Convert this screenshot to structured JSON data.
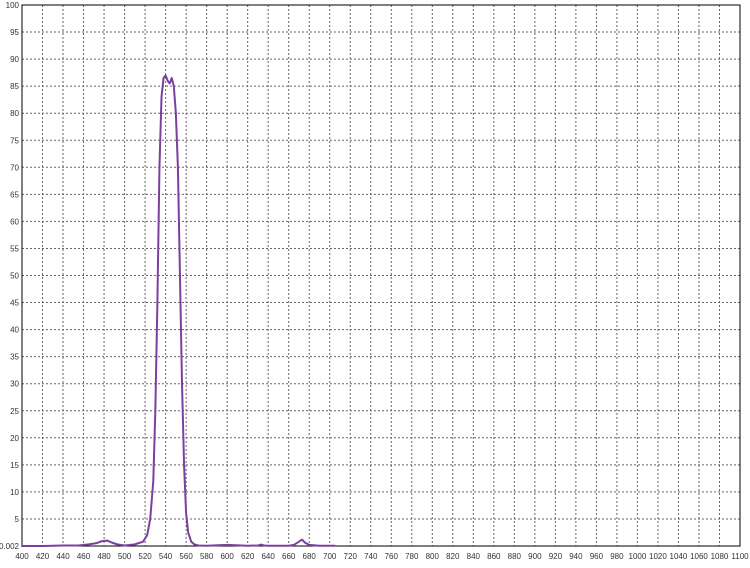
{
  "chart_data": {
    "type": "line",
    "title": "",
    "xlabel": "",
    "ylabel": "",
    "xlim": [
      400,
      1100
    ],
    "ylim": [
      0,
      100
    ],
    "grid": true,
    "x_ticks": [
      400,
      420,
      440,
      460,
      480,
      500,
      520,
      540,
      560,
      580,
      600,
      620,
      640,
      660,
      680,
      700,
      720,
      740,
      760,
      780,
      800,
      820,
      840,
      860,
      880,
      900,
      920,
      940,
      960,
      980,
      1000,
      1020,
      1040,
      1060,
      1080,
      1100
    ],
    "y_ticks": [
      0.002,
      5,
      10,
      15,
      20,
      25,
      30,
      35,
      40,
      45,
      50,
      55,
      60,
      65,
      70,
      75,
      80,
      85,
      90,
      95,
      100
    ],
    "colors": {
      "series": "#7b3fa0",
      "axis": "#000000",
      "grid": "#666666"
    },
    "series": [
      {
        "x": [
          400,
          420,
          440,
          455,
          465,
          472,
          478,
          483,
          488,
          493,
          500,
          510,
          518,
          522,
          525,
          528,
          530,
          532,
          534,
          536,
          538,
          540,
          542,
          544,
          546,
          548,
          550,
          552,
          554,
          556,
          558,
          560,
          562,
          565,
          568,
          572,
          580,
          600,
          620,
          630,
          633,
          636,
          640,
          660,
          665,
          670,
          673,
          676,
          680,
          690,
          700,
          705
        ],
        "y": [
          0.002,
          0.002,
          0.1,
          0.1,
          0.3,
          0.5,
          0.9,
          1.0,
          0.6,
          0.3,
          0.1,
          0.3,
          0.8,
          2,
          5,
          12,
          25,
          45,
          70,
          83,
          86.5,
          87,
          86,
          85.5,
          86.5,
          85,
          80,
          70,
          50,
          30,
          15,
          6,
          2.5,
          0.8,
          0.3,
          0.1,
          0.05,
          0.2,
          0.05,
          0.1,
          0.25,
          0.1,
          0.05,
          0.05,
          0.2,
          0.8,
          1.2,
          0.6,
          0.2,
          0.05,
          0.05,
          0.05
        ]
      }
    ]
  }
}
